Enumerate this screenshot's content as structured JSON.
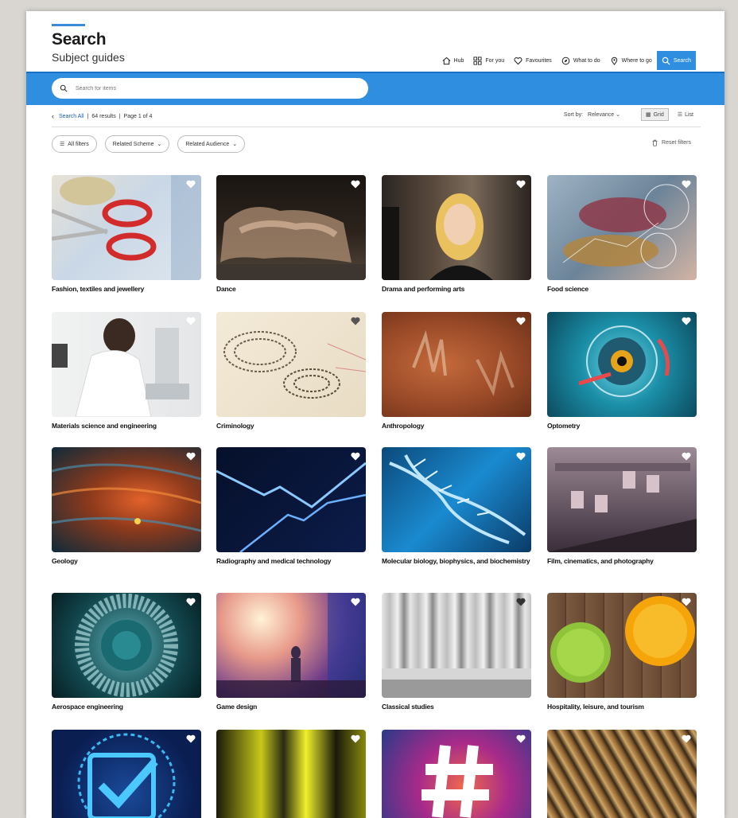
{
  "header": {
    "title": "Search",
    "subtitle": "Subject guides"
  },
  "nav": [
    {
      "label": "Hub",
      "icon": "home-icon"
    },
    {
      "label": "For you",
      "icon": "grid-icon"
    },
    {
      "label": "Favourites",
      "icon": "heart-icon"
    },
    {
      "label": "What to do",
      "icon": "compass-icon"
    },
    {
      "label": "Where to go",
      "icon": "location-pin-icon"
    },
    {
      "label": "Search",
      "icon": "search-icon",
      "active": true
    }
  ],
  "search": {
    "placeholder": "Search for items",
    "value": ""
  },
  "breadcrumb": {
    "back": "Search All",
    "results": "64 results",
    "page": "Page 1 of 4"
  },
  "sort": {
    "label": "Sort by:",
    "value": "Relevance",
    "grid": "Grid",
    "list": "List"
  },
  "filters": {
    "all": "All filters",
    "scheme": "Related Scheme",
    "audience": "Related Audience",
    "reset": "Reset filters"
  },
  "colors": {
    "accent": "#2f8ee0"
  },
  "items": [
    {
      "label": "Fashion, textiles and jewellery"
    },
    {
      "label": "Dance"
    },
    {
      "label": "Drama and performing arts"
    },
    {
      "label": "Food science"
    },
    {
      "label": "Materials science and engineering"
    },
    {
      "label": "Criminology"
    },
    {
      "label": "Anthropology"
    },
    {
      "label": "Optometry"
    },
    {
      "label": "Geology"
    },
    {
      "label": "Radiography and medical technology"
    },
    {
      "label": "Molecular biology, biophysics, and biochemistry"
    },
    {
      "label": "Film, cinematics, and photography"
    },
    {
      "label": "Aerospace engineering"
    },
    {
      "label": "Game design"
    },
    {
      "label": "Classical studies"
    },
    {
      "label": "Hospitality, leisure, and tourism"
    },
    {
      "label": ""
    },
    {
      "label": ""
    },
    {
      "label": ""
    },
    {
      "label": ""
    }
  ]
}
